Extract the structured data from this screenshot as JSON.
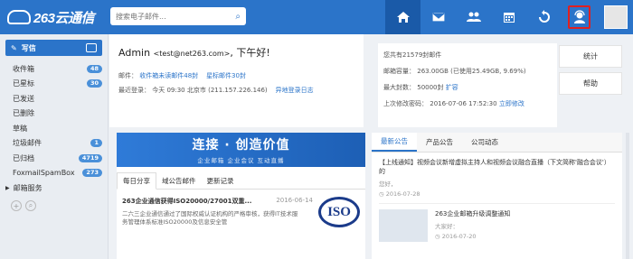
{
  "header": {
    "logo_text": "263云通信",
    "search_placeholder": "搜索电子邮件..."
  },
  "nav_icons": [
    {
      "name": "home-icon"
    },
    {
      "name": "mail-icon"
    },
    {
      "name": "contacts-icon"
    },
    {
      "name": "calendar-icon"
    },
    {
      "name": "sync-icon"
    },
    {
      "name": "user-service-icon"
    }
  ],
  "sidebar": {
    "compose_label": "写信",
    "folders": [
      {
        "label": "收件箱",
        "badge": "48"
      },
      {
        "label": "已星标",
        "badge": "30"
      },
      {
        "label": "已发送",
        "badge": ""
      },
      {
        "label": "已删除",
        "badge": ""
      },
      {
        "label": "草稿",
        "badge": ""
      },
      {
        "label": "垃圾邮件",
        "badge": "1"
      },
      {
        "label": "已归档",
        "badge": "4719"
      },
      {
        "label": "FoxmailSpamBox",
        "badge": "273"
      }
    ],
    "group_label": "邮箱服务"
  },
  "welcome": {
    "name": "Admin",
    "email": "<test@net263.com>",
    "greeting": ", 下午好!",
    "mail_label": "邮件：",
    "unread_link": "收件箱未读邮件48封",
    "starred_link": "星标邮件30封",
    "last_login_label": "最近登录：",
    "last_login_value": "今天 09:30 北京市  (211.157.226.146)",
    "abnormal_link": "异地登录日志"
  },
  "stats": {
    "total": "您共有21579封邮件",
    "capacity_label": "邮箱容量：",
    "capacity_value": "263.00GB (已使用25.49GB, 9.69%)",
    "max_count_label": "最大封数：",
    "max_count_value": "50000封",
    "expand_link": "扩容",
    "pwd_label": "上次修改密码：",
    "pwd_value": "2016-07-06 17:52:30",
    "modify_link": "立即修改"
  },
  "quick_buttons": {
    "stats": "统计",
    "help": "帮助"
  },
  "banner": {
    "main": "连接 · 创造价值",
    "sub": "企业邮箱  企业会议  互动直播"
  },
  "share_tabs": [
    "每日分享",
    "域公告邮件",
    "更新记录"
  ],
  "share_item": {
    "title": "263企业通信获得ISO20000/27001双重...",
    "date": "2016-06-14",
    "body": "二六三企业通信通过了国际权威认证机构的严格审核，获得IT技术服务管理体系标准ISO20000及信息安全管",
    "logo": "ISO"
  },
  "notice_tabs": [
    "最新公告",
    "产品公告",
    "公司动态"
  ],
  "notices": [
    {
      "title": "【上线通知】视频会议新增虚拟主持人和视频会议融合直播（下文简称'融合会议'）的",
      "meta": "您好，",
      "date": "2016-07-28"
    },
    {
      "title": "263企业邮箱升级调整通知",
      "meta": "大家好：",
      "date": "2016-07-20"
    }
  ]
}
